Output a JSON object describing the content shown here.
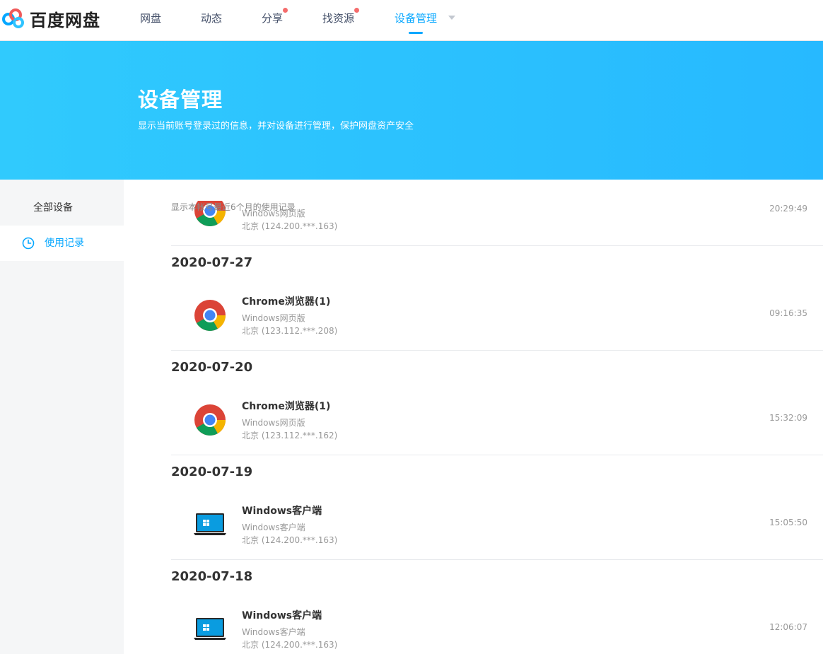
{
  "colors": {
    "accent": "#06a7ff",
    "banner_start": "#30cafd",
    "banner_end": "#27b9ff",
    "dot": "#f56c6c"
  },
  "header": {
    "logo_text": "百度网盘",
    "nav": [
      {
        "label": "网盘"
      },
      {
        "label": "动态"
      },
      {
        "label": "分享"
      },
      {
        "label": "找资源"
      },
      {
        "label": "设备管理"
      }
    ]
  },
  "banner": {
    "title": "设备管理",
    "subtitle": "显示当前账号登录过的信息，并对设备进行管理，保护网盘资产安全"
  },
  "sidebar": {
    "items": [
      {
        "label": "全部设备"
      },
      {
        "label": "使用记录"
      }
    ]
  },
  "main": {
    "note": "显示本帐号最近6个月的使用记录",
    "partial_entry": {
      "icon": "chrome-icon",
      "type": "Windows网页版",
      "location": "北京 (124.200.***.163)",
      "time": "20:29:49"
    },
    "groups": [
      {
        "date": "2020-07-27",
        "entries": [
          {
            "icon": "chrome-icon",
            "name": "Chrome浏览器(1)",
            "type": "Windows网页版",
            "location": "北京 (123.112.***.208)",
            "time": "09:16:35"
          }
        ]
      },
      {
        "date": "2020-07-20",
        "entries": [
          {
            "icon": "chrome-icon",
            "name": "Chrome浏览器(1)",
            "type": "Windows网页版",
            "location": "北京 (123.112.***.162)",
            "time": "15:32:09"
          }
        ]
      },
      {
        "date": "2020-07-19",
        "entries": [
          {
            "icon": "laptop-icon",
            "name": "Windows客户端",
            "type": "Windows客户端",
            "location": "北京 (124.200.***.163)",
            "time": "15:05:50"
          }
        ]
      },
      {
        "date": "2020-07-18",
        "entries": [
          {
            "icon": "laptop-icon",
            "name": "Windows客户端",
            "type": "Windows客户端",
            "location": "北京 (124.200.***.163)",
            "time": "12:06:07"
          }
        ]
      }
    ]
  }
}
